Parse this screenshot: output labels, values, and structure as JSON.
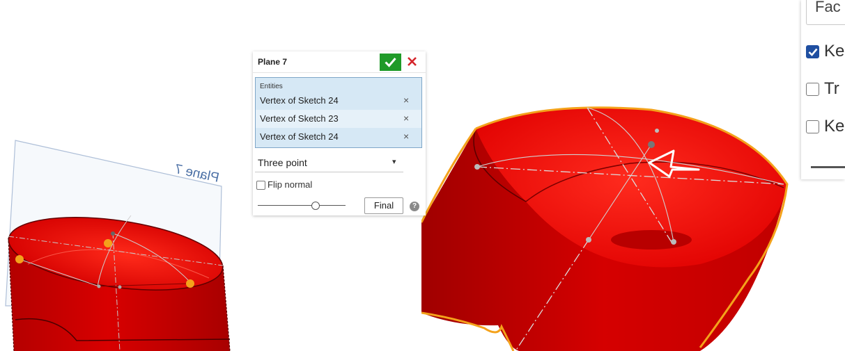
{
  "left_viewport": {
    "plane_label": "Plane 7"
  },
  "dialog": {
    "title": "Plane 7",
    "entities_label": "Entities",
    "entities": [
      {
        "label": "Vertex of Sketch 24"
      },
      {
        "label": "Vertex of Sketch 23"
      },
      {
        "label": "Vertex of Sketch 24"
      }
    ],
    "remove_glyph": "×",
    "type_select": "Three point",
    "caret": "▾",
    "flip_normal_label": "Flip normal",
    "flip_normal_checked": false,
    "slider_position": 0.65,
    "final_label": "Final",
    "help_glyph": "?"
  },
  "right_panel": {
    "input_text": "Fac",
    "options": [
      {
        "label": "Ke",
        "checked": true
      },
      {
        "label": "Tr",
        "checked": false
      },
      {
        "label": "Ke",
        "checked": false
      }
    ]
  },
  "colors": {
    "accent_ok": "#1f9a28",
    "cancel": "#d4242a",
    "entity_highlight": "#d6e8f5",
    "part_red": "#e60000",
    "selection_orange": "#f4a21b",
    "checkbox_blue": "#1f4fa1"
  },
  "icons": [
    "checkmark-icon",
    "close-icon",
    "remove-entity-icon",
    "dropdown-caret-icon",
    "help-icon"
  ]
}
